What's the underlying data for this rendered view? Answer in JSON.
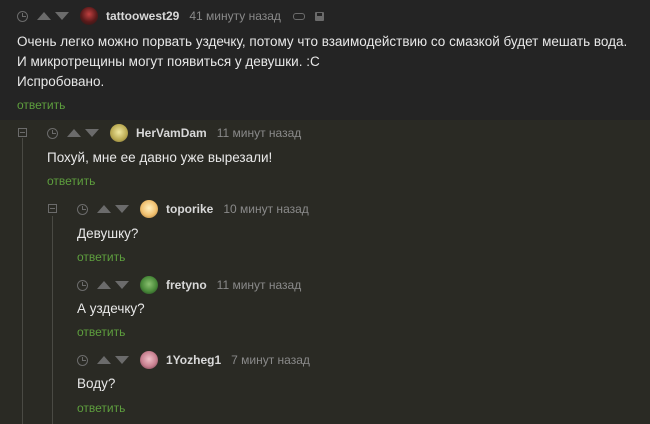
{
  "comments": [
    {
      "username": "tattoowest29",
      "timestamp": "41 минуту назад",
      "lines": [
        "Очень легко можно порвать уздечку, потому что взаимодействию со смазкой будет мешать вода.",
        "И микротрещины могут появиться у девушки. :C",
        "Испробовано."
      ],
      "reply_label": "ответить",
      "avatar_color": "#5a1a1a"
    },
    {
      "username": "HerVamDam",
      "timestamp": "11 минут назад",
      "lines": [
        "Похуй, мне ее давно уже вырезали!"
      ],
      "reply_label": "ответить",
      "avatar_color": "#c8c070"
    },
    {
      "username": "toporike",
      "timestamp": "10 минут назад",
      "lines": [
        "Девушку?"
      ],
      "reply_label": "ответить",
      "avatar_color": "#f0c070"
    },
    {
      "username": "fretyno",
      "timestamp": "11 минут назад",
      "lines": [
        "А уздечку?"
      ],
      "reply_label": "ответить",
      "avatar_color": "#4a8a3a"
    },
    {
      "username": "1Yozheg1",
      "timestamp": "7 минут назад",
      "lines": [
        "Воду?"
      ],
      "reply_label": "ответить",
      "avatar_color": "#c88090"
    }
  ],
  "colors": {
    "reply": "#5e9f3e",
    "background": "#242424",
    "nested_background": "#2a2a24"
  }
}
